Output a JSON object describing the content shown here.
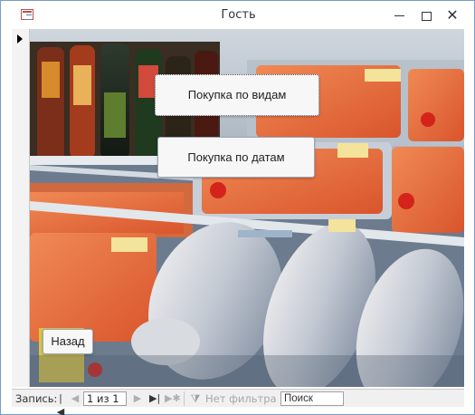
{
  "window": {
    "title": "Гость",
    "minimize_icon": "minimize-icon",
    "maximize_icon": "maximize-icon",
    "close_icon": "close-icon",
    "close_glyph": "✕"
  },
  "form": {
    "buttons": {
      "by_types": "Покупка по видам",
      "by_dates": "Покупка по датам",
      "back": "Назад"
    },
    "background_image": "fish-display-case"
  },
  "navigation": {
    "label": "Запись:",
    "first_icon": "first-record-icon",
    "prev_icon": "previous-record-icon",
    "record_value": "1 из 1",
    "next_icon": "next-record-icon",
    "last_icon": "last-record-icon",
    "new_icon": "new-record-icon",
    "filter_icon": "filter-icon",
    "filter_label": "Нет фильтра",
    "search_placeholder": "Поиск"
  },
  "colors": {
    "window_border": "#7a9cc6",
    "accent": "#c0504d"
  }
}
